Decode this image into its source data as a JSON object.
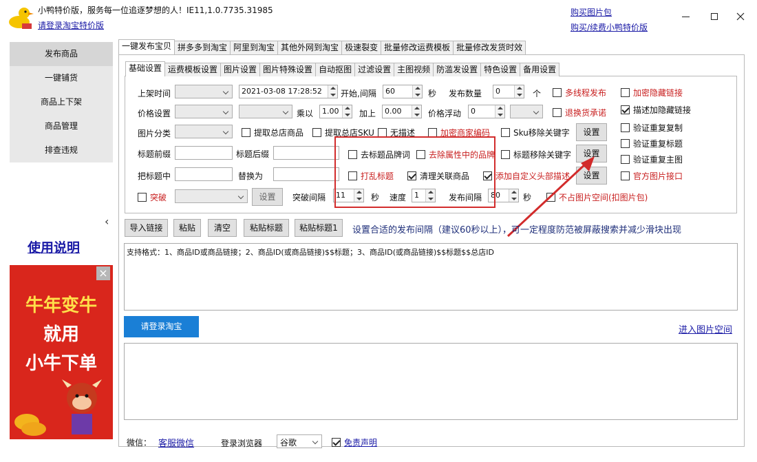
{
  "window": {
    "title": "小鸭特价版，服务每一位追逐梦想的人！IE11,1.0.7735.31985",
    "login_link": "请登录淘宝特价版",
    "buy_pic_pack": "购买图片包",
    "buy_renew": "购买/续费小鸭特价版"
  },
  "sidebar": {
    "items": [
      {
        "label": "发布商品"
      },
      {
        "label": "一键铺货"
      },
      {
        "label": "商品上下架"
      },
      {
        "label": "商品管理"
      },
      {
        "label": "排查违规"
      }
    ],
    "collapse_glyph": "‹",
    "manual_link": "使用说明",
    "ad": {
      "line1": "牛年变牛",
      "line2": "就用",
      "line3": "小牛下单",
      "close": "×"
    }
  },
  "top_tabs": [
    {
      "label": "一键发布宝贝"
    },
    {
      "label": "拼多多到淘宝"
    },
    {
      "label": "阿里到淘宝"
    },
    {
      "label": "其他外网到淘宝"
    },
    {
      "label": "极速裂变"
    },
    {
      "label": "批量修改运费模板"
    },
    {
      "label": "批量修改发货时效"
    }
  ],
  "sub_tabs": [
    {
      "label": "基础设置"
    },
    {
      "label": "运费模板设置"
    },
    {
      "label": "图片设置"
    },
    {
      "label": "图片特殊设置"
    },
    {
      "label": "自动抠图"
    },
    {
      "label": "过滤设置"
    },
    {
      "label": "主图视频"
    },
    {
      "label": "防滥发设置"
    },
    {
      "label": "特色设置"
    },
    {
      "label": "备用设置"
    }
  ],
  "form": {
    "shelf_time_label": "上架时间",
    "datetime_value": "2021-03-08 17:28:52",
    "start_interval_label": "开始,间隔",
    "interval_value": "60",
    "sec": "秒",
    "publish_count_label": "发布数量",
    "publish_count_value": "0",
    "unit_ge": "个",
    "multithread": "多线程发布",
    "encrypt_hidden_link": "加密隐藏链接",
    "price_label": "价格设置",
    "multiply_label": "乘以",
    "multiply_value": "1.00",
    "add_label": "加上",
    "add_value": "0.00",
    "float_label": "价格浮动",
    "float_value": "0",
    "refund_promise": "退换货承诺",
    "desc_hidden_link": "描述加隐藏链接",
    "category_label": "图片分类",
    "fetch_store_goods": "提取总店商品",
    "fetch_store_sku": "提取总店SKU",
    "no_desc": "无描述",
    "encrypt_merchant_code": "加密商家编码",
    "sku_remove_keyword": "Sku移除关键字",
    "settings": "设置",
    "verify_dup_copy": "验证重复复制",
    "title_prefix_label": "标题前缀",
    "title_suffix_label": "标题后缀",
    "remove_title_brand": "去标题品牌词",
    "remove_attr_brand": "去除属性中的品牌",
    "title_remove_keyword": "标题移除关键字",
    "verify_dup_title": "验证重复标题",
    "replace_in_title_label": "把标题中",
    "replace_with_label": "替换为",
    "shuffle_title": "打乱标题",
    "clean_related": "清理关联商品",
    "add_custom_header": "添加自定义头部描述",
    "verify_dup_main": "验证重复主图",
    "official_pic_api": "官方图片接口",
    "breakthrough": "突破",
    "set_btn": "设置",
    "break_interval_label": "突破间隔",
    "break_interval_value": "11",
    "speed_label": "速度",
    "speed_value": "1",
    "publish_interval_label": "发布间隔",
    "publish_interval_value": "80",
    "no_pic_space": "不占图片空间(扣图片包)"
  },
  "checked": {
    "desc_hidden_link": true,
    "clean_related": true,
    "add_custom_header": true,
    "no_pic_space": false
  },
  "toolbar": {
    "import_links": "导入链接",
    "paste": "粘贴",
    "clear": "清空",
    "paste_title": "粘贴标题",
    "paste_title_1": "粘贴标题1",
    "hint": "设置合适的发布间隔（建议60秒以上），可一定程度防范被屏蔽搜索并减少滑块出现"
  },
  "textarea_text": "支持格式：1、商品ID或商品链接；2、商品ID(或商品链接)$$标题；3、商品ID(或商品链接)$$标题$$总店ID",
  "login_taobao_button": "请登录淘宝",
  "enter_pic_space": "进入图片空间",
  "footer": {
    "wechat_label": "微信：",
    "service_wechat": "客服微信",
    "browser_label": "登录浏览器",
    "browser_value": "谷歌",
    "disclaimer": "免责声明"
  },
  "colors": {
    "accent_blue": "#1a7fd6",
    "highlight_red": "#d22b2b",
    "warning_text": "#c81e1e"
  }
}
